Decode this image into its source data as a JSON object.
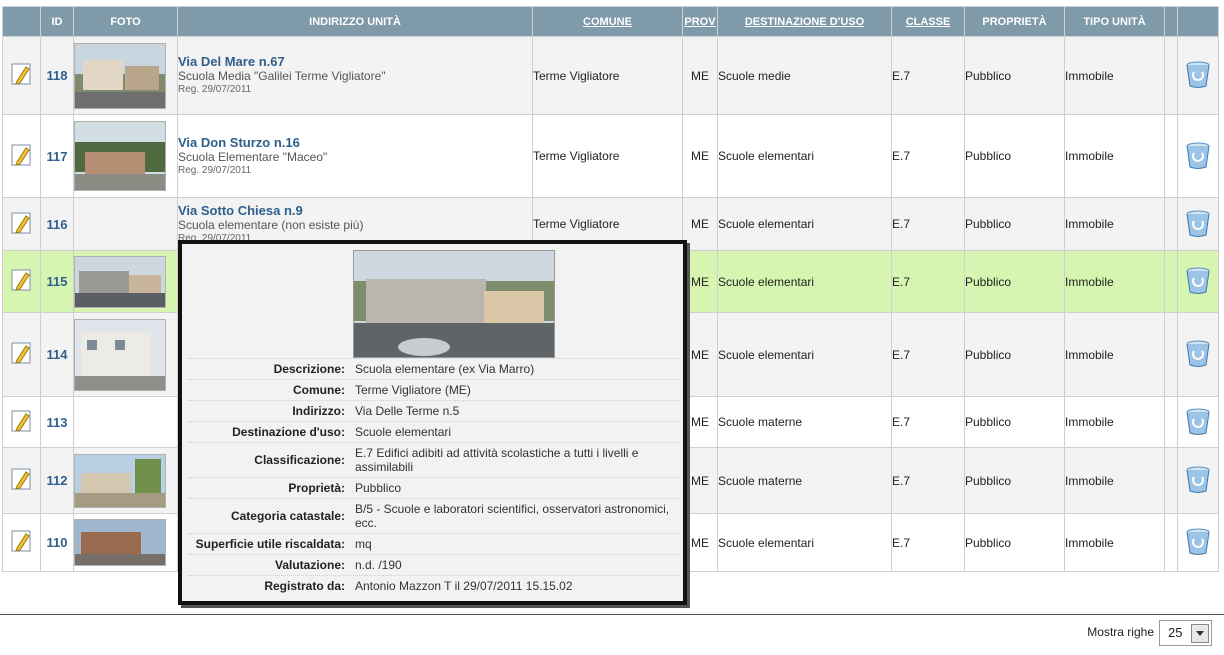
{
  "columns": {
    "id": "ID",
    "foto": "FOTO",
    "indirizzo": "INDIRIZZO UNITÀ",
    "comune": "COMUNE",
    "prov": "PROV",
    "destinazione": "DESTINAZIONE D'USO",
    "classe": "CLASSE",
    "proprieta": "PROPRIETÀ",
    "tipo": "TIPO UNITÀ"
  },
  "rows": [
    {
      "id": "118",
      "title": "Via Del Mare n.67",
      "sub": "Scuola Media \"Galilei Terme Vigliatore\"",
      "reg": "Reg. 29/07/2011",
      "comune": "Terme Vigliatore",
      "prov": "ME",
      "destinazione": "Scuole medie",
      "classe": "E.7",
      "proprieta": "Pubblico",
      "tipo": "Immobile"
    },
    {
      "id": "117",
      "title": "Via Don Sturzo n.16",
      "sub": "Scuola Elementare \"Maceo\"",
      "reg": "Reg. 29/07/2011",
      "comune": "Terme Vigliatore",
      "prov": "ME",
      "destinazione": "Scuole elementari",
      "classe": "E.7",
      "proprieta": "Pubblico",
      "tipo": "Immobile"
    },
    {
      "id": "116",
      "title": "Via Sotto Chiesa n.9",
      "sub": "Scuola elementare (non esiste più)",
      "reg": "Reg. 29/07/2011",
      "comune": "Terme Vigliatore",
      "prov": "ME",
      "destinazione": "Scuole elementari",
      "classe": "E.7",
      "proprieta": "Pubblico",
      "tipo": "Immobile"
    },
    {
      "id": "115",
      "title": "",
      "sub": "",
      "reg": "",
      "comune": "",
      "prov": "ME",
      "destinazione": "Scuole elementari",
      "classe": "E.7",
      "proprieta": "Pubblico",
      "tipo": "Immobile"
    },
    {
      "id": "114",
      "title": "",
      "sub": "",
      "reg": "",
      "comune": "",
      "prov": "ME",
      "destinazione": "Scuole elementari",
      "classe": "E.7",
      "proprieta": "Pubblico",
      "tipo": "Immobile"
    },
    {
      "id": "113",
      "title": "",
      "sub": "",
      "reg": "",
      "comune": "",
      "prov": "ME",
      "destinazione": "Scuole materne",
      "classe": "E.7",
      "proprieta": "Pubblico",
      "tipo": "Immobile"
    },
    {
      "id": "112",
      "title": "",
      "sub": "",
      "reg": "",
      "comune": "",
      "prov": "ME",
      "destinazione": "Scuole materne",
      "classe": "E.7",
      "proprieta": "Pubblico",
      "tipo": "Immobile"
    },
    {
      "id": "110",
      "title": "",
      "sub": "",
      "reg": "",
      "comune": "",
      "prov": "ME",
      "destinazione": "Scuole elementari",
      "classe": "E.7",
      "proprieta": "Pubblico",
      "tipo": "Immobile"
    }
  ],
  "popup": {
    "items": [
      {
        "label": "Descrizione:",
        "value": "Scuola elementare (ex Via Marro)"
      },
      {
        "label": "Comune:",
        "value": "Terme Vigliatore (ME)"
      },
      {
        "label": "Indirizzo:",
        "value": "Via Delle Terme n.5"
      },
      {
        "label": "Destinazione d'uso:",
        "value": "Scuole elementari"
      },
      {
        "label": "Classificazione:",
        "value": "E.7 Edifici adibiti ad attività scolastiche a tutti i livelli e assimilabili"
      },
      {
        "label": "Proprietà:",
        "value": "Pubblico"
      },
      {
        "label": "Categoria catastale:",
        "value": "B/5 - Scuole e laboratori scientifici, osservatori astronomici, ecc."
      },
      {
        "label": "Superficie utile riscaldata:",
        "value": "mq"
      },
      {
        "label": "Valutazione:",
        "value": "n.d. /190"
      },
      {
        "label": "Registrato da:",
        "value": "Antonio Mazzon T il 29/07/2011 15.15.02"
      }
    ]
  },
  "footer": {
    "mostra_label": "Mostra righe",
    "rows_value": "25"
  },
  "icons": {
    "edit": "edit-pencil-icon",
    "delete": "recycle-bin-icon"
  },
  "colors": {
    "header": "#7f9aa8",
    "highlight_row": "#d6f5b0",
    "link": "#2f5f8c"
  }
}
